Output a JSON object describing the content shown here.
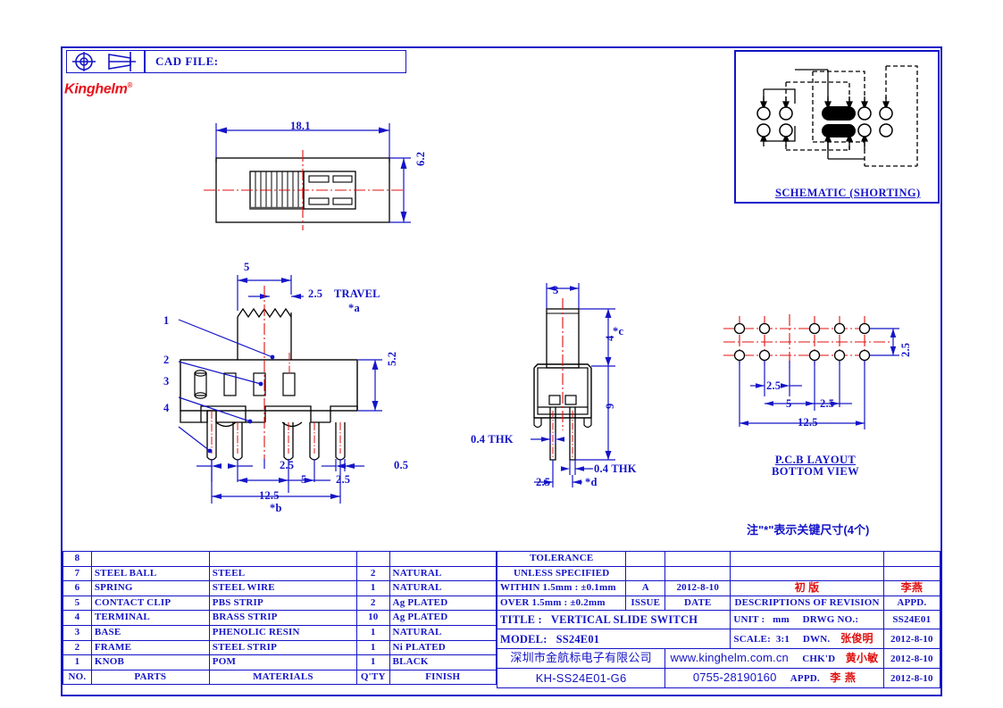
{
  "header": {
    "cad_file_label": "CAD FILE:",
    "brand": "Kinghelm",
    "brand_mark": "®",
    "projection_symbol": "first-angle-projection"
  },
  "schematic": {
    "caption": "SCHEMATIC (SHORTING)"
  },
  "top_view": {
    "width_dim": "18.1",
    "height_dim": "6.2"
  },
  "front_view": {
    "knob_width": "5",
    "travel_dim": "2.5",
    "travel_label": "TRAVEL",
    "travel_star": "*a",
    "body_height": "5.2",
    "pitch_1": "2.5",
    "pitch_2": "5",
    "pitch_3": "2.5",
    "pin_thk": "0.5",
    "overall": "12.5",
    "overall_star": "*b",
    "balloons": [
      "1",
      "2",
      "3",
      "4"
    ]
  },
  "side_view": {
    "knob_width": "3",
    "knob_height": "4",
    "knob_star": "*c",
    "total_height": "9",
    "thk_left": "0.4 THK",
    "thk_right": "0.4  THK",
    "pin_pitch": "2.5",
    "pin_star": "*d"
  },
  "pcb_view": {
    "row_pitch": "2.5",
    "pitch_1": "2.5",
    "pitch_2": "5",
    "pitch_3": "2.5",
    "overall": "12.5",
    "caption_line1": "P.C.B LAYOUT",
    "caption_line2": "BOTTOM VIEW"
  },
  "note": "注\"*\"表示关键尺寸(4个)",
  "parts_table": {
    "headers": {
      "no": "NO.",
      "parts": "PARTS",
      "materials": "MATERIALS",
      "qty": "Q'TY",
      "finish": "FINISH"
    },
    "rows": [
      {
        "no": "8",
        "parts": "",
        "materials": "",
        "qty": "",
        "finish": ""
      },
      {
        "no": "7",
        "parts": "STEEL BALL",
        "materials": "STEEL",
        "qty": "2",
        "finish": "NATURAL"
      },
      {
        "no": "6",
        "parts": "SPRING",
        "materials": "STEEL WIRE",
        "qty": "1",
        "finish": "NATURAL"
      },
      {
        "no": "5",
        "parts": "CONTACT CLIP",
        "materials": "PBS STRIP",
        "qty": "2",
        "finish": "Ag PLATED"
      },
      {
        "no": "4",
        "parts": "TERMINAL",
        "materials": "BRASS STRIP",
        "qty": "10",
        "finish": "Ag PLATED"
      },
      {
        "no": "3",
        "parts": "BASE",
        "materials": "PHENOLIC RESIN",
        "qty": "1",
        "finish": "NATURAL"
      },
      {
        "no": "2",
        "parts": "FRAME",
        "materials": "STEEL STRIP",
        "qty": "1",
        "finish": "Ni PLATED"
      },
      {
        "no": "1",
        "parts": "KNOB",
        "materials": "POM",
        "qty": "1",
        "finish": "BLACK"
      }
    ]
  },
  "title_block": {
    "tolerance_line1": "TOLERANCE",
    "tolerance_line2": "UNLESS  SPECIFIED",
    "tol_within": "WITHIN 1.5mm : ±0.1mm",
    "tol_over": "OVER 1.5mm : ±0.2mm",
    "issue_value": "A",
    "issue_label": "ISSUE",
    "date_value": "2012-8-10",
    "date_label": "DATE",
    "revision_value": "初  版",
    "revision_label": "DESCRIPTIONS  OF  REVISION",
    "appd_top_name": "李燕",
    "appd_top_label": "APPD.",
    "title_label": "TITLE :",
    "title_value": "VERTICAL SLIDE SWITCH",
    "model_label": "MODEL:",
    "model_value": "SS24E01",
    "unit_label": "UNIT :",
    "unit_value": "mm",
    "scale_label": "SCALE:",
    "scale_value": "3:1",
    "drwg_label": "DRWG NO.:",
    "drwg_value": "SS24E01",
    "dwn_label": "DWN.",
    "dwn_name": "张俊明",
    "dwn_date": "2012-8-10",
    "chkd_label": "CHK'D",
    "chkd_name": "黄小敏",
    "chkd_date": "2012-8-10",
    "appd_label": "APPD.",
    "appd_name": "李 燕",
    "appd_date": "2012-8-10",
    "company_cn": "深圳市金航标电子有限公司",
    "website": "www.kinghelm.com.cn",
    "part_number": "KH-SS24E01-G6",
    "phone": "0755-28190160"
  },
  "colors": {
    "line": "#1414c8",
    "centerline": "#e01010",
    "brand": "#e8111a",
    "black": "#000000"
  }
}
